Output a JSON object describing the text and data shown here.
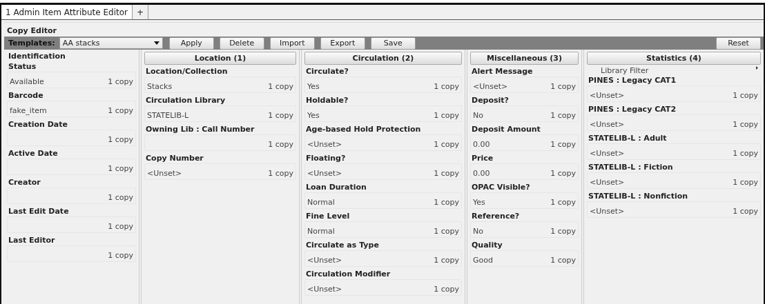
{
  "tabs": [
    {
      "label": "1 Admin Item Attribute Editor",
      "selected": true
    },
    {
      "label": "+",
      "selected": false
    }
  ],
  "copy_editor": {
    "title": "Copy Editor",
    "toolbar": {
      "templates_label": "Templates:",
      "template_value": "AA stacks",
      "buttons": [
        "Apply",
        "Delete",
        "Import",
        "Export",
        "Save"
      ],
      "reset": "Reset"
    },
    "columns": [
      {
        "kind": "plain",
        "heading": "Identification",
        "fields": [
          {
            "label": "Status",
            "value": "Available",
            "count": "1 copy"
          },
          {
            "label": "Barcode",
            "value": "fake_item",
            "count": "1 copy"
          },
          {
            "label": "Creation Date",
            "count": "1 copy"
          },
          {
            "label": "Active Date",
            "count": "1 copy"
          },
          {
            "label": "Creator",
            "count": "1 copy"
          },
          {
            "label": "Last Edit Date",
            "count": "1 copy"
          },
          {
            "label": "Last Editor",
            "count": "1 copy"
          }
        ]
      },
      {
        "kind": "button",
        "heading": "Location (1)",
        "fields": [
          {
            "label": "Location/Collection",
            "value": "Stacks",
            "count": "1 copy"
          },
          {
            "label": "Circulation Library",
            "value": "STATELIB-L",
            "count": "1 copy"
          },
          {
            "label": "Owning Lib : Call Number",
            "count": "1 copy"
          },
          {
            "label": "Copy Number",
            "value": "<Unset>",
            "count": "1 copy"
          }
        ]
      },
      {
        "kind": "button",
        "heading": "Circulation (2)",
        "fields": [
          {
            "label": "Circulate?",
            "value": "Yes",
            "count": "1 copy"
          },
          {
            "label": "Holdable?",
            "value": "Yes",
            "count": "1 copy"
          },
          {
            "label": "Age-based Hold Protection",
            "value": "<Unset>",
            "count": "1 copy"
          },
          {
            "label": "Floating?",
            "value": "<Unset>",
            "count": "1 copy"
          },
          {
            "label": "Loan Duration",
            "value": "Normal",
            "count": "1 copy"
          },
          {
            "label": "Fine Level",
            "value": "Normal",
            "count": "1 copy"
          },
          {
            "label": "Circulate as Type",
            "value": "<Unset>",
            "count": "1 copy"
          },
          {
            "label": "Circulation Modifier",
            "value": "<Unset>",
            "count": "1 copy"
          }
        ]
      },
      {
        "kind": "button",
        "heading": "Miscellaneous (3)",
        "fields": [
          {
            "label": "Alert Message",
            "value": "<Unset>",
            "count": "1 copy"
          },
          {
            "label": "Deposit?",
            "value": "No",
            "count": "1 copy"
          },
          {
            "label": "Deposit Amount",
            "value": "0.00",
            "count": "1 copy"
          },
          {
            "label": "Price",
            "value": "0.00",
            "count": "1 copy"
          },
          {
            "label": "OPAC Visible?",
            "value": "Yes",
            "count": "1 copy"
          },
          {
            "label": "Reference?",
            "value": "No",
            "count": "1 copy"
          },
          {
            "label": "Quality",
            "value": "Good",
            "count": "1 copy"
          }
        ]
      },
      {
        "kind": "button",
        "heading": "Statistics (4)",
        "filter": "Library Filter",
        "fields": [
          {
            "label": "PINES : Legacy CAT1",
            "value": "<Unset>",
            "count": "1 copy"
          },
          {
            "label": "PINES : Legacy CAT2",
            "value": "<Unset>",
            "count": "1 copy"
          },
          {
            "label": "STATELIB-L : Adult",
            "value": "<Unset>",
            "count": "1 copy"
          },
          {
            "label": "STATELIB-L : Fiction",
            "value": "<Unset>",
            "count": "1 copy"
          },
          {
            "label": "STATELIB-L : Nonfiction",
            "value": "<Unset>",
            "count": "1 copy"
          }
        ]
      }
    ]
  }
}
